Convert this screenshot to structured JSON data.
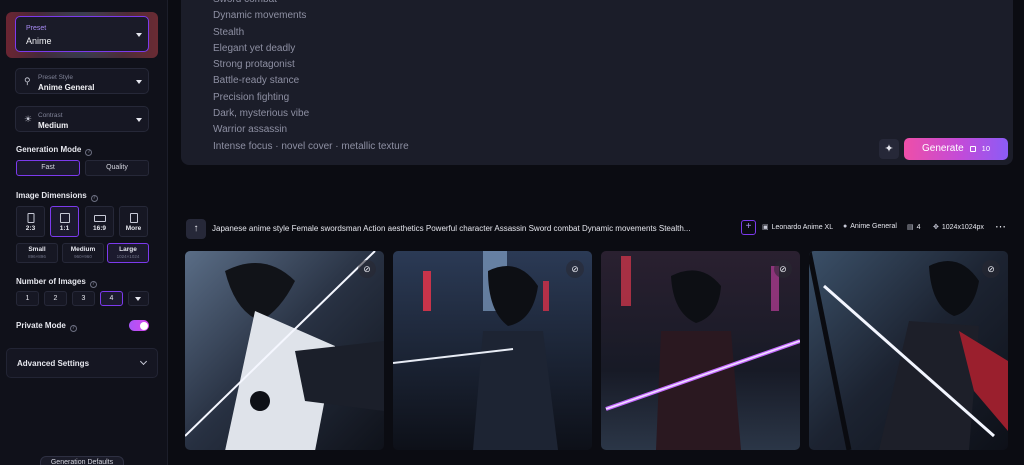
{
  "sidebar": {
    "preset": {
      "label": "Preset",
      "value": "Anime"
    },
    "preset_style": {
      "label": "Preset Style",
      "value": "Anime General"
    },
    "contrast": {
      "label": "Contrast",
      "value": "Medium"
    },
    "generation_mode": {
      "label": "Generation Mode",
      "options": [
        "Fast",
        "Quality"
      ],
      "selected": "Fast"
    },
    "image_dimensions": {
      "label": "Image Dimensions",
      "ratios": [
        "2:3",
        "1:1",
        "16:9",
        "More"
      ],
      "selected_ratio": "1:1",
      "sizes": [
        {
          "label": "Small",
          "dims": "896×896"
        },
        {
          "label": "Medium",
          "dims": "960×960"
        },
        {
          "label": "Large",
          "dims": "1024×1024"
        }
      ],
      "selected_size": "Large"
    },
    "number_of_images": {
      "label": "Number of Images",
      "options": [
        "1",
        "2",
        "3",
        "4"
      ],
      "selected": "4"
    },
    "private_mode": {
      "label": "Private Mode",
      "enabled": true
    },
    "advanced": {
      "label": "Advanced Settings"
    },
    "bottom_button": {
      "label": "Generation Defaults"
    }
  },
  "prompt": {
    "lines": [
      "Sword combat",
      "Dynamic movements",
      "Stealth",
      "Elegant yet deadly",
      "Strong protagonist",
      "Battle-ready stance",
      "Precision fighting",
      "Dark, mysterious vibe",
      "Warrior assassin",
      "Intense focus · novel cover    · metallic texture"
    ],
    "generate_label": "Generate",
    "generate_cost": "10"
  },
  "generation": {
    "prompt_text": "Japanese anime style Female swordsman Action aesthetics Powerful character Assassin Sword combat Dynamic movements Stealth...",
    "model": "Leonardo Anime XL",
    "style": "Anime General",
    "count": "4",
    "dimensions": "1024x1024px"
  },
  "colors": {
    "accent": "#7c3aed",
    "generate_start": "#ee4fa8",
    "generate_end": "#8b5cf6",
    "background": "#0b0c12",
    "panel": "#1b1d29"
  }
}
